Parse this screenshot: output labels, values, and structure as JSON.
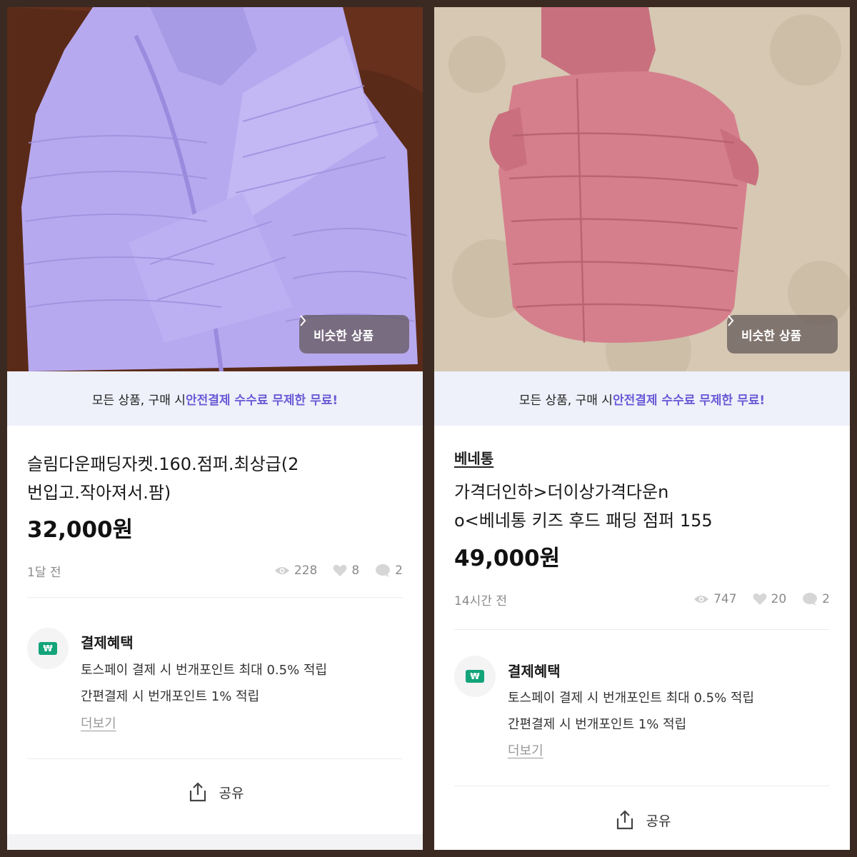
{
  "colors": {
    "accent": "#6a5bd6",
    "banner_bg": "#eef0fa",
    "benefit_green": "#13a47a"
  },
  "left": {
    "similar_button": "비슷한 상품",
    "banner_prefix": "모든 상품, 구매 시 ",
    "banner_highlight": "안전결제 수수료 무제한 무료!",
    "title_line1": "슬림다운패딩자켓.160.점퍼.최상급(2",
    "title_line2": "번입고.작아져서.팜)",
    "price": "32,000원",
    "time_ago": "1달 전",
    "views": "228",
    "likes": "8",
    "chats": "2",
    "benefit_title": "결제혜택",
    "benefit_line1": "토스페이 결제 시 번개포인트 최대 0.5% 적립",
    "benefit_line2": "간편결제 시 번개포인트 1% 적립",
    "more": "더보기",
    "share": "공유"
  },
  "right": {
    "similar_button": "비슷한 상품",
    "banner_prefix": "모든 상품, 구매 시 ",
    "banner_highlight": "안전결제 수수료 무제한 무료!",
    "brand": "베네통",
    "title_line1": "가격더인하>더이상가격다운n",
    "title_line2": "o<베네통 키즈 후드 패딩 점퍼 155",
    "price": "49,000원",
    "time_ago": "14시간 전",
    "views": "747",
    "likes": "20",
    "chats": "2",
    "benefit_title": "결제혜택",
    "benefit_line1": "토스페이 결제 시 번개포인트 최대 0.5% 적립",
    "benefit_line2": "간편결제 시 번개포인트 1% 적립",
    "more": "더보기",
    "share": "공유"
  },
  "icons": {
    "views": "eye-icon",
    "likes": "heart-icon",
    "chats": "chat-bubble-icon",
    "share": "share-icon",
    "similar": "chevron-right-icon",
    "benefit": "won-payment-icon"
  }
}
